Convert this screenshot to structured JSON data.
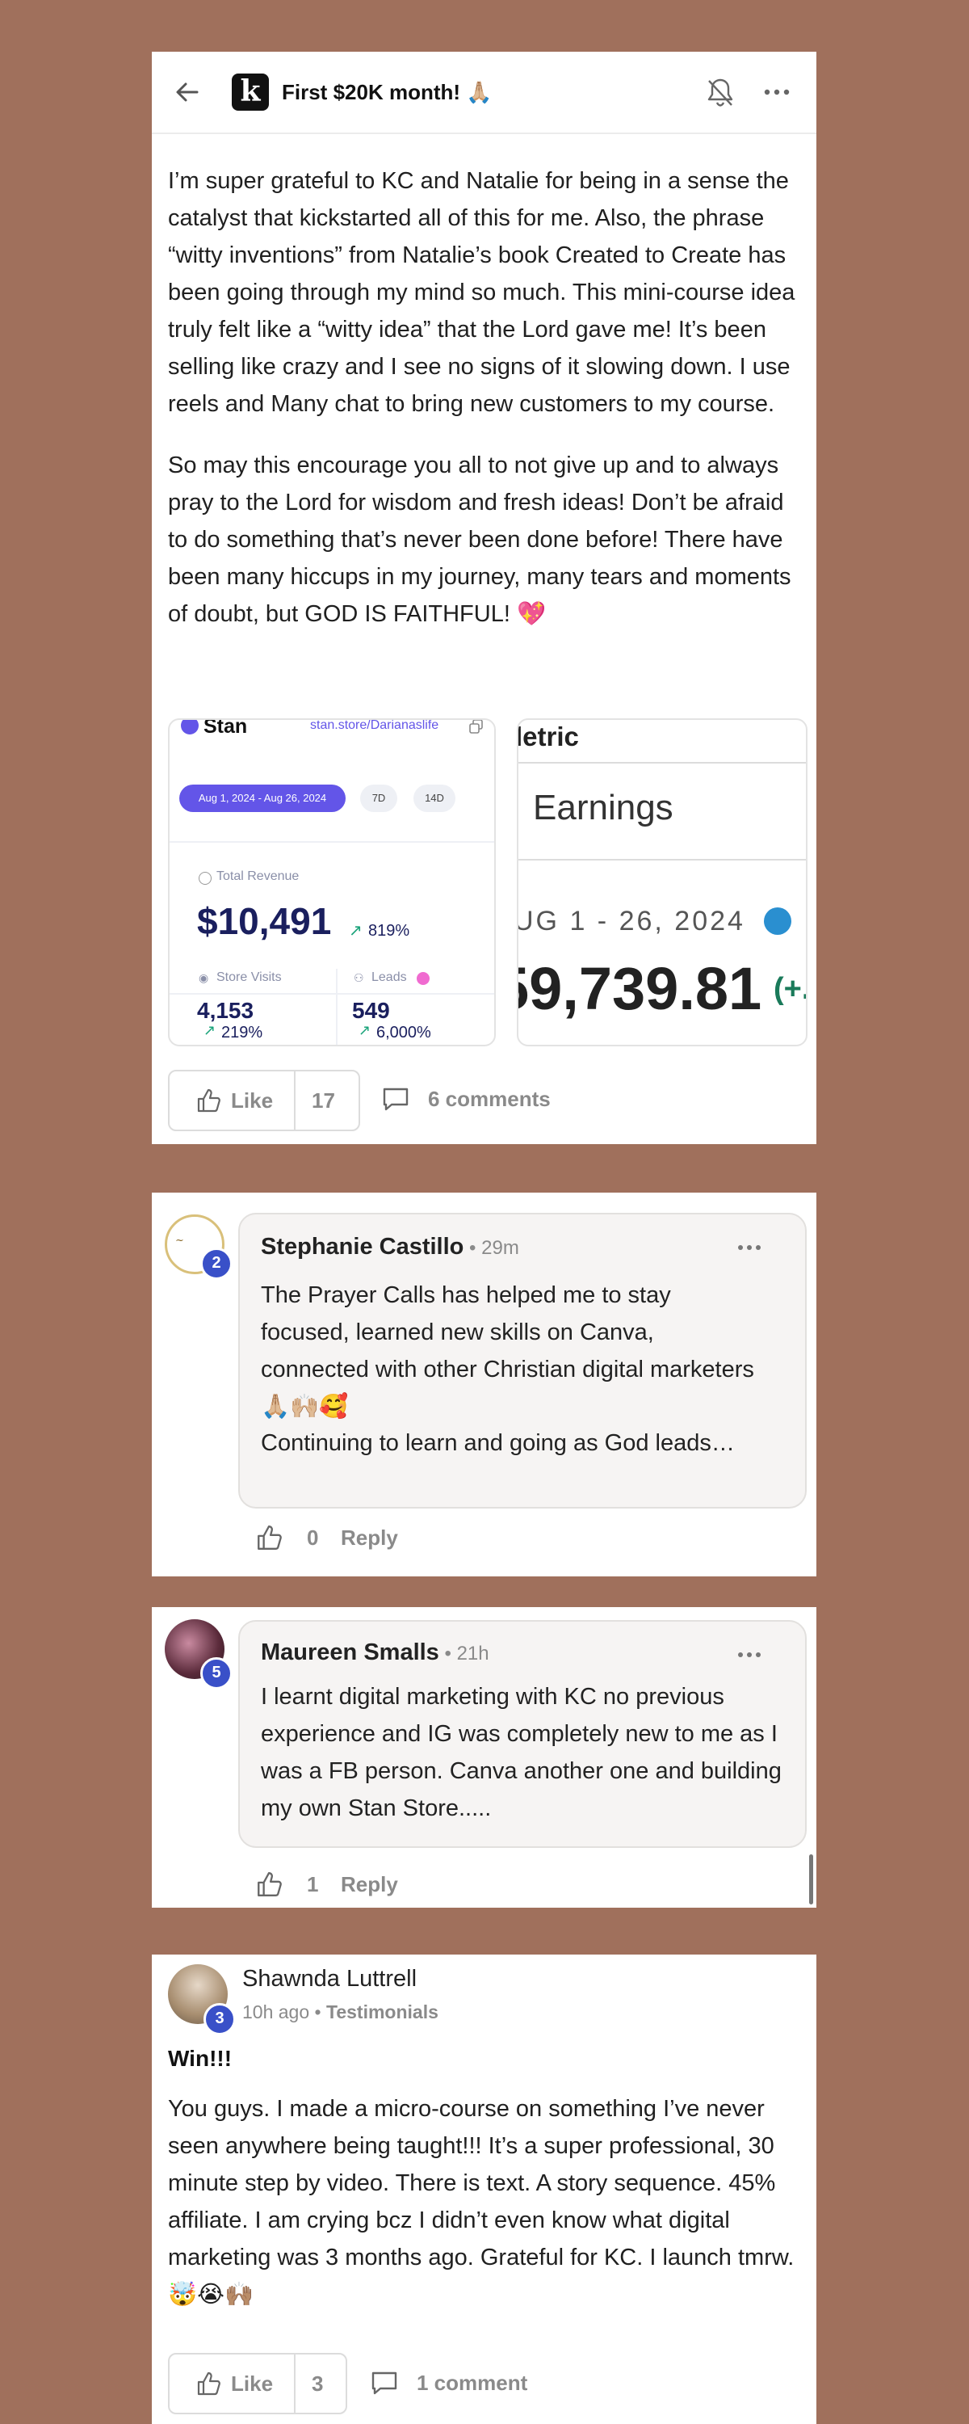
{
  "post": {
    "title": "First $20K month! 🙏🏼",
    "paragraphs": [
      "I’m super grateful to KC and Natalie for being in a sense the catalyst that kickstarted all of this for me. Also, the phrase “witty inventions” from Natalie’s book Created to Create has been going through my mind so much. This mini-course idea truly felt like a “witty idea” that the Lord gave me! It’s been selling like crazy and I see no signs of it slowing down. I use reels and Many chat to bring new customers to my course.",
      "So may this encourage you all to not give up and to always pray to the Lord for wisdom and fresh ideas! Don’t be afraid to do something that’s never been done before! There have been many hiccups in my journey, many tears and moments of doubt, but GOD IS FAITHFUL! 💖"
    ],
    "like_label": "Like",
    "like_count": "17",
    "comments_label": "6 comments"
  },
  "stan_image": {
    "brand": "Stan",
    "url": "stan.store/Darianaslife",
    "date_range": "Aug 1, 2024 - Aug 26, 2024",
    "range_7d": "7D",
    "range_14d": "14D",
    "revenue_label": "Total Revenue",
    "revenue_value": "$10,491",
    "revenue_change": "819%",
    "visits_label": "Store Visits",
    "visits_value": "4,153",
    "visits_change": "219%",
    "leads_label": "Leads",
    "leads_value": "549",
    "leads_change": "6,000%"
  },
  "earnings_image": {
    "brand": "letric",
    "title": "Earnings",
    "date_range": "UG 1 - 26, 2024",
    "value": "59,739.81",
    "change": "(+."
  },
  "comments": [
    {
      "name": "Stephanie Castillo",
      "time": "29m",
      "level": "2",
      "text": "The Prayer Calls has helped me to stay focused, learned new skills on Canva, connected with other Christian digital marketers 🙏🏼🙌🏼🥰",
      "text2": "Continuing to learn and going as God leads…",
      "likes": "0",
      "reply_label": "Reply"
    },
    {
      "name": "Maureen Smalls",
      "time": "21h",
      "level": "5",
      "text": "I learnt digital marketing with KC no previous experience and IG was completely new to me as I was a FB person. Canva another one and building my own Stan Store.....",
      "likes": "1",
      "reply_label": "Reply"
    }
  ],
  "post2": {
    "author": "Shawnda Luttrell",
    "level": "3",
    "time": "10h ago",
    "category": "Testimonials",
    "title": "Win!!!",
    "text": "You guys. I made a micro-course on something I’ve never seen anywhere being taught!!! It’s a super professional, 30 minute step by video. There is text. A story sequence. 45% affiliate. I am crying bcz I didn’t even know what digital marketing was 3 months ago. Grateful for KC. I launch tmrw. 🤯😭🙌🏽",
    "like_label": "Like",
    "like_count": "3",
    "comments_label": "1 comment"
  },
  "colors": {
    "background": "#a0705c",
    "accent": "#3950c8",
    "stan_purple": "#6355e8",
    "stan_navy": "#1a1f5e",
    "growth_green": "#1aa37a",
    "earnings_blue": "#2a8fd0"
  },
  "icons": [
    "back-arrow-icon",
    "bell-icon",
    "more-icon",
    "thumbs-up-icon",
    "comment-icon"
  ]
}
